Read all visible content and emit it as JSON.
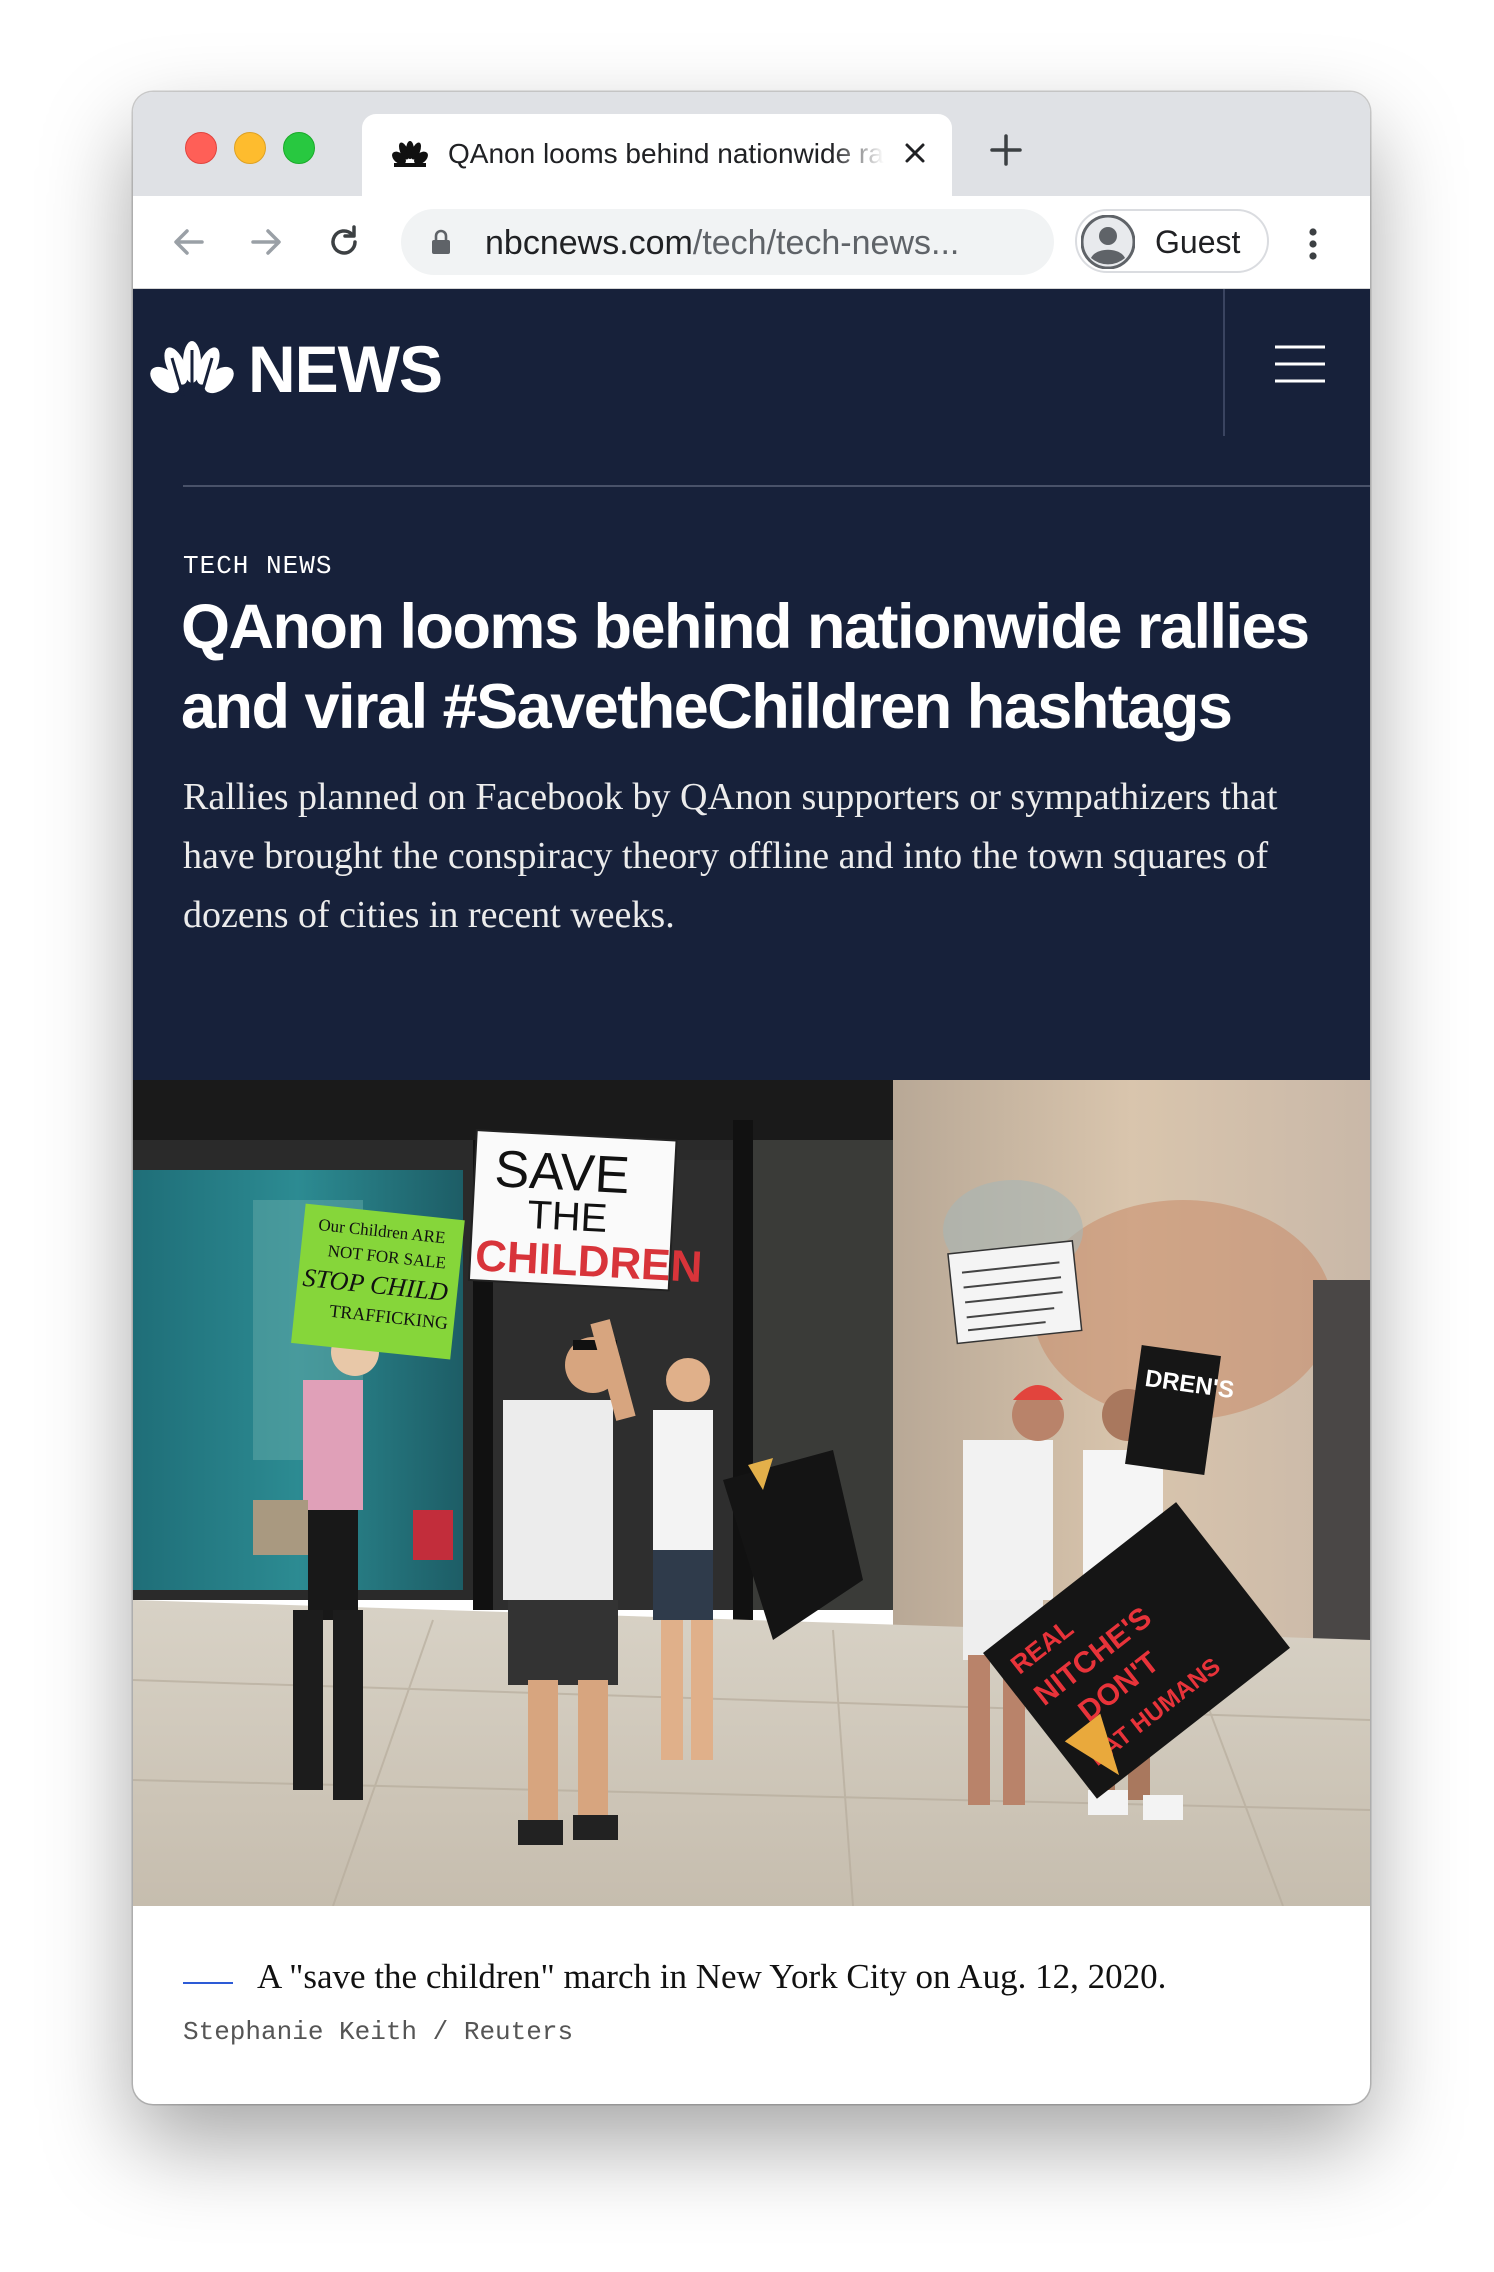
{
  "browser": {
    "tab_title": "QAnon looms behind nationwide rallies and viral #SavetheChildren hashtags",
    "url_domain": "nbcnews.com",
    "url_path": "/tech/tech-news...",
    "profile_name": "Guest"
  },
  "site": {
    "logo_text": "NEWS",
    "brand_colors": [
      "#17213a",
      "#ffffff"
    ]
  },
  "article": {
    "kicker": "TECH NEWS",
    "headline": "QAnon looms behind nationwide rallies and viral #SavetheChildren hashtags",
    "dek": "Rallies planned on Facebook by QAnon supporters or sympathizers that have brought the conspiracy theory offline and into the town squares of dozens of cities in recent weeks.",
    "photo_signs": [
      "SAVE",
      "THE",
      "CHILDREN",
      "Our Children ARE",
      "NOT FOR SALE",
      "STOP CHILD",
      "TRAFFICKING",
      "REAL",
      "NITCHE'S",
      "DON'T",
      "EAT HUMANS"
    ],
    "caption": "A \"save the children\" march in New York City on Aug. 12, 2020.",
    "credit": "Stephanie Keith / Reuters"
  }
}
